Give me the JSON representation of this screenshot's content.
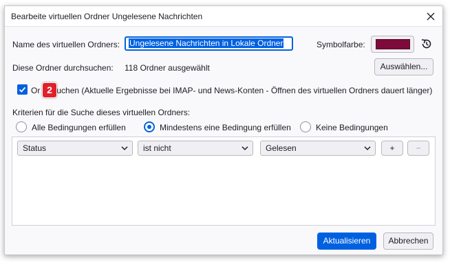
{
  "dialog": {
    "title": "Bearbeite virtuellen Ordner Ungelesene Nachrichten"
  },
  "form": {
    "name_label": "Name des virtuellen Ordners:",
    "name_value": "Ungelesene Nachrichten in Lokale Ordner",
    "color_label": "Symbolfarbe:",
    "color_value": "#7d0a3a",
    "search_label": "Diese Ordner durchsuchen:",
    "search_value": "118 Ordner ausgewählt",
    "choose_button": "Auswählen...",
    "online_search_label_start": "Or",
    "online_search_label_rest": "suchen (Aktuelle Ergebnisse bei IMAP- und News-Konten - Öffnen des virtuellen Ordners dauert länger)",
    "online_search_checked": true,
    "badge_number": "2"
  },
  "criteria": {
    "heading": "Kriterien für die Suche dieses virtuellen Ordners:",
    "options": [
      "Alle Bedingungen erfüllen",
      "Mindestens eine Bedingung erfüllen",
      "Keine Bedingungen"
    ],
    "selected_index": 1,
    "rule": {
      "field": "Status",
      "operator": "ist nicht",
      "value": "Gelesen"
    },
    "add_label": "+",
    "remove_label": "−"
  },
  "footer": {
    "update_button": "Aktualisieren",
    "cancel_button": "Abbrechen"
  },
  "colors": {
    "accent": "#0061e0",
    "badge": "#e0202a"
  }
}
